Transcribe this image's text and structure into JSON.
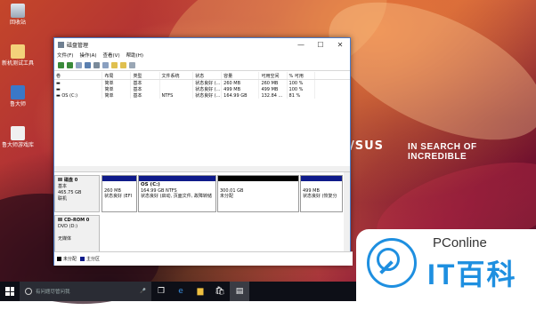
{
  "desktop": {
    "icons": [
      {
        "label": "回收站"
      },
      {
        "label": "新机测试工具"
      },
      {
        "label": "鲁大师"
      },
      {
        "label": "鲁大师游戏库"
      }
    ],
    "brand": "/SUS",
    "slogan": "IN SEARCH OF INCREDIBLE"
  },
  "window": {
    "title": "磁盘管理",
    "min": "—",
    "max": "☐",
    "close": "✕",
    "menu": [
      "文件(F)",
      "操作(A)",
      "查看(V)",
      "帮助(H)"
    ],
    "table": {
      "headers": [
        "卷",
        "布局",
        "类型",
        "文件系统",
        "状态",
        "容量",
        "可用空间",
        "% 可用",
        ""
      ],
      "rows": [
        [
          "▬",
          "简单",
          "基本",
          "",
          "状态良好 (...",
          "260 MB",
          "260 MB",
          "100 %",
          ""
        ],
        [
          "▬",
          "简单",
          "基本",
          "",
          "状态良好 (...",
          "499 MB",
          "499 MB",
          "100 %",
          ""
        ],
        [
          "▬ OS (C:)",
          "简单",
          "基本",
          "NTFS",
          "状态良好 (...",
          "164.99 GB",
          "132.84 ...",
          "81 %",
          ""
        ]
      ]
    },
    "disk0": {
      "name": "磁盘 0",
      "kind": "基本",
      "size": "465.75 GB",
      "status": "联机",
      "partitions": [
        {
          "title": "",
          "size": "260 MB",
          "status": "状态良好 (EFI"
        },
        {
          "title": "OS (C:)",
          "size": "164.99 GB NTFS",
          "status": "状态良好 (启动, 页面文件, 故障转储"
        },
        {
          "title": "",
          "size": "300.01 GB",
          "status": "未分配"
        },
        {
          "title": "",
          "size": "499 MB",
          "status": "状态良好 (恢复分"
        }
      ]
    },
    "cdrom": {
      "name": "CD-ROM 0",
      "kind": "DVD (D:)",
      "status": "无媒体"
    },
    "legend": [
      {
        "label": "未分配",
        "color": "#000000"
      },
      {
        "label": "主分区",
        "color": "#0f1b8a"
      }
    ]
  },
  "taskbar": {
    "search_placeholder": "有问题尽管问我"
  },
  "watermark": {
    "top": "PConline",
    "main": "IT百科"
  }
}
